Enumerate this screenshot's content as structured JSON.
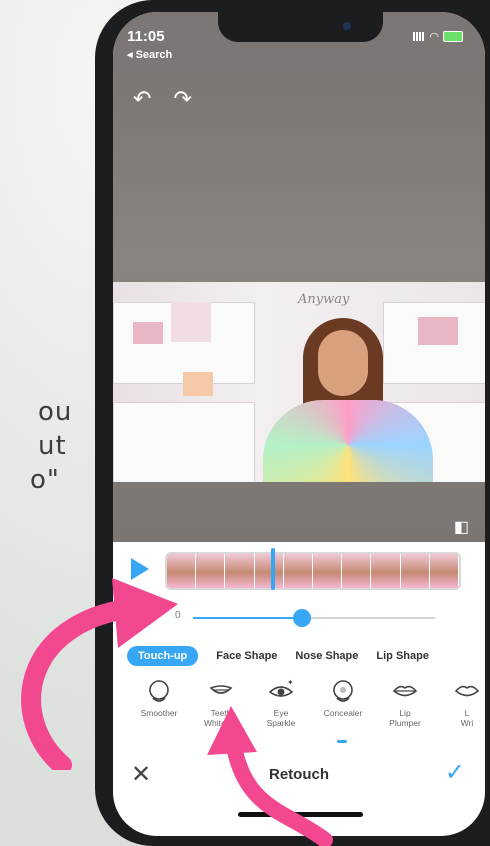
{
  "background_text": [
    "ou",
    "ut",
    "o\""
  ],
  "status": {
    "time": "11:05",
    "back": "◂ Search"
  },
  "editor": {
    "undo_icon": "undo-icon",
    "redo_icon": "redo-icon",
    "video_sign": "Anyway"
  },
  "slider": {
    "value": "0",
    "fraction": 0.45
  },
  "tabs": [
    "Touch-up",
    "Face Shape",
    "Nose Shape",
    "Lip Shape"
  ],
  "tools": [
    {
      "label": "Smoother"
    },
    {
      "label": "Teeth\nWhitener"
    },
    {
      "label": "Eye\nSparkle"
    },
    {
      "label": "Concealer"
    },
    {
      "label": "Lip\nPlumper"
    },
    {
      "label": "L\nWri"
    }
  ],
  "bottom": {
    "title": "Retouch"
  },
  "colors": {
    "accent": "#37a6f5",
    "arrow": "#f2488f"
  }
}
